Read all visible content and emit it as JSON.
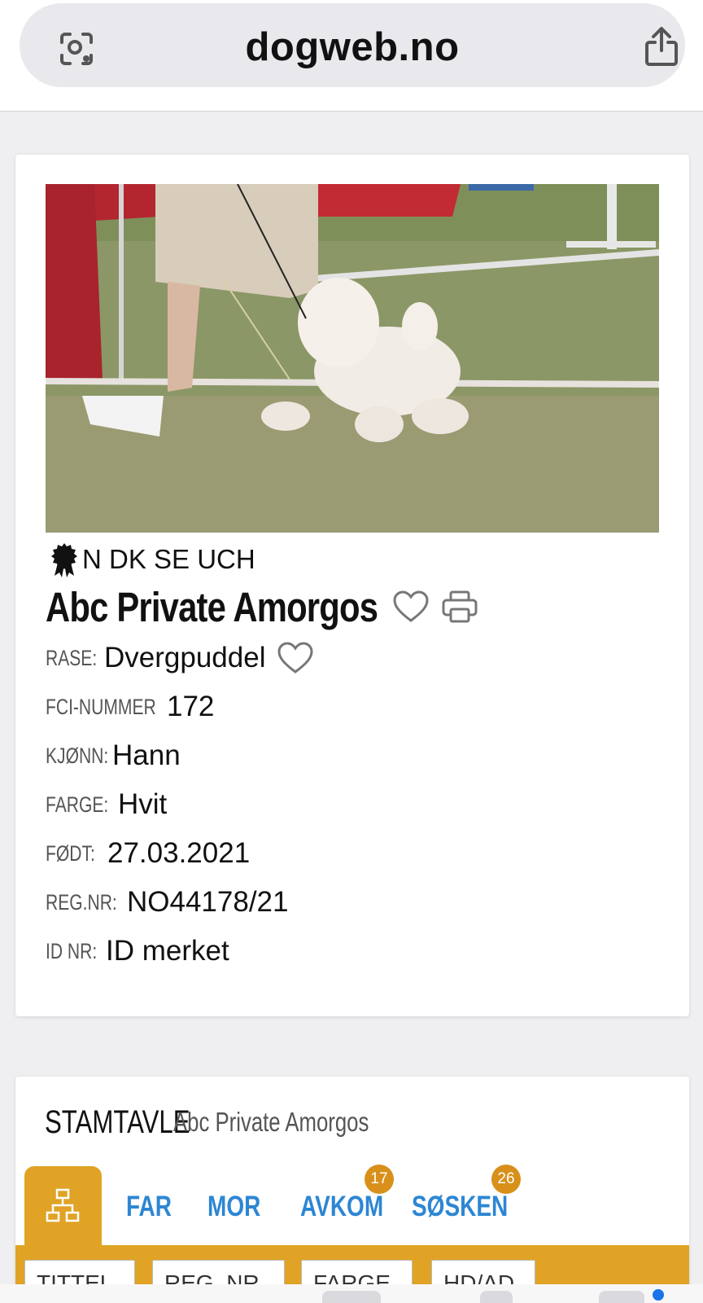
{
  "browser": {
    "url": "dogweb.no",
    "icons": {
      "left": "visual-search-icon",
      "right": "share-icon"
    }
  },
  "dog": {
    "titles": "N DK SE UCH",
    "name": "Abc Private Amorgos",
    "fields": [
      {
        "label": "RASE:",
        "value": "Dvergpuddel"
      },
      {
        "label": "FCI-NUMMER",
        "value": "172"
      },
      {
        "label": "KJØNN:",
        "value": "Hann"
      },
      {
        "label": "FARGE:",
        "value": "Hvit"
      },
      {
        "label": "FØDT:",
        "value": "27.03.2021"
      },
      {
        "label": "REG.NR:",
        "value": "NO44178/21"
      },
      {
        "label": "ID NR:",
        "value": "ID merket"
      }
    ]
  },
  "pedigree": {
    "title": "STAMTAVLE",
    "subtitle": "Abc Private Amorgos",
    "tabs": [
      {
        "label": "FAR"
      },
      {
        "label": "MOR"
      },
      {
        "label": "AVKOM",
        "badge": "17"
      },
      {
        "label": "SØSKEN",
        "badge": "26"
      }
    ],
    "columns": [
      "TITTEL",
      "REG. NR",
      "FARGE",
      "HD/AD"
    ]
  },
  "colors": {
    "accent": "#e0a325",
    "link": "#2d86d3",
    "badge": "#d8901b"
  }
}
